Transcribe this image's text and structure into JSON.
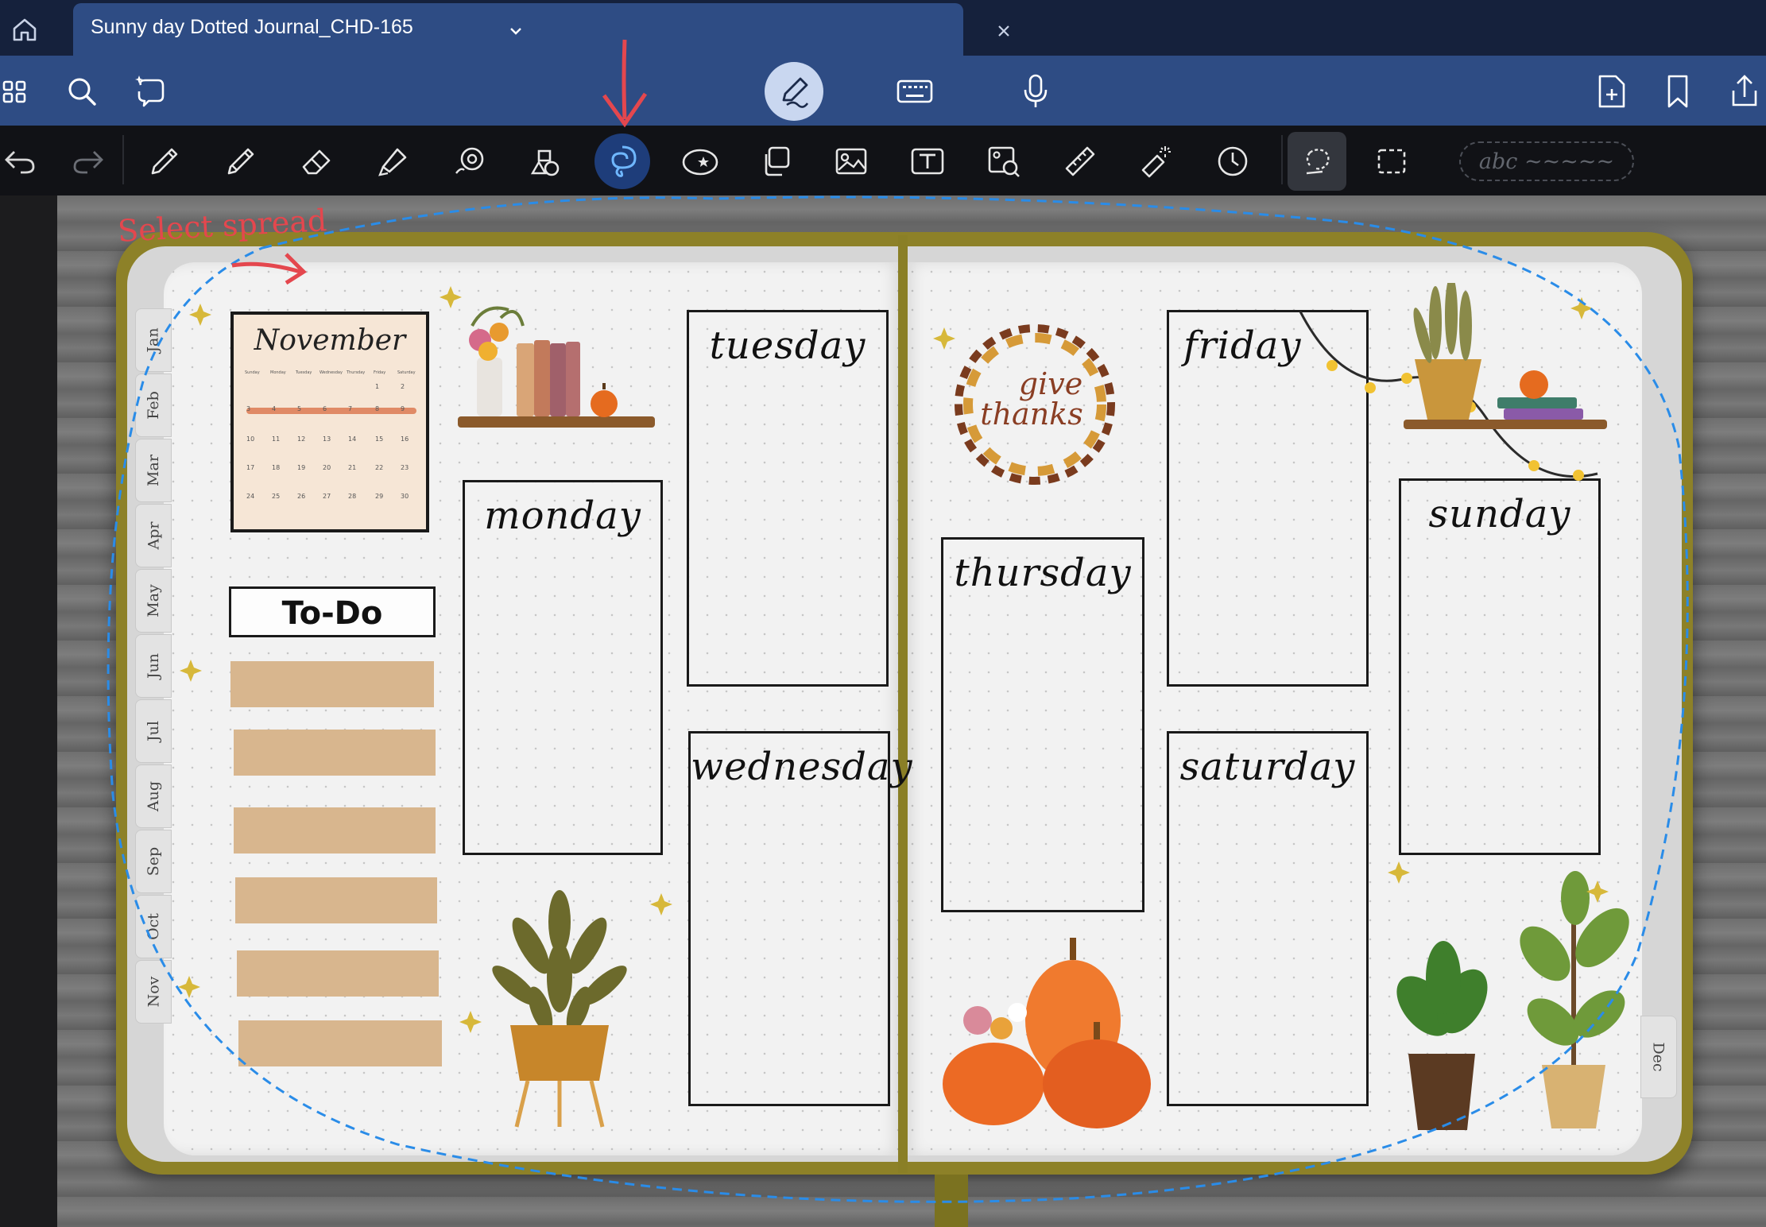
{
  "tab": {
    "title": "Sunny day Dotted Journal_CHD-165",
    "icons": [
      "home-icon",
      "chevron-down-icon",
      "close-icon"
    ]
  },
  "main_toolbar": {
    "left_icons": [
      "thumbnails-grid-icon",
      "search-icon",
      "ai-lasso-icon"
    ],
    "center_icons": [
      "pen-mode-icon",
      "keyboard-icon",
      "microphone-icon"
    ],
    "right_icons": [
      "add-page-icon",
      "bookmark-icon",
      "share-icon"
    ]
  },
  "tools": {
    "items": [
      "undo-icon",
      "redo-icon",
      "pen-icon",
      "pencil-icon",
      "eraser-icon",
      "highlighter-icon",
      "shape-icon",
      "elements-icon",
      "lasso-tool-icon",
      "sticker-icon",
      "copy-icon",
      "image-icon",
      "text-box-icon",
      "camera-image-icon",
      "ruler-icon",
      "laser-pointer-icon",
      "clock-icon",
      "lasso-select-icon",
      "rectangle-select-icon"
    ],
    "handwriting_placeholder": "abc ~~~~~",
    "active_tool": "lasso-tool-icon",
    "accent": "#1e3d7a"
  },
  "annotation": {
    "text": "Select spread",
    "color": "#e4474e"
  },
  "planner": {
    "months": [
      "Jan",
      "Feb",
      "Mar",
      "Apr",
      "May",
      "Jun",
      "Jul",
      "Aug",
      "Sep",
      "Oct",
      "Nov"
    ],
    "right_month": "Dec",
    "calendar": {
      "title": "November",
      "weekdays": [
        "Sunday",
        "Monday",
        "Tuesday",
        "Wednesday",
        "Thursday",
        "Friday",
        "Saturday"
      ],
      "rows": [
        [
          "",
          "",
          "",
          "",
          "",
          "1",
          "2"
        ],
        [
          "3",
          "4",
          "5",
          "6",
          "7",
          "8",
          "9"
        ],
        [
          "10",
          "11",
          "12",
          "13",
          "14",
          "15",
          "16"
        ],
        [
          "17",
          "18",
          "19",
          "20",
          "21",
          "22",
          "23"
        ],
        [
          "24",
          "25",
          "26",
          "27",
          "28",
          "29",
          "30"
        ]
      ]
    },
    "todo": "To-Do",
    "days": {
      "monday": "monday",
      "tuesday": "tuesday",
      "wednesday": "wednesday",
      "thursday": "thursday",
      "friday": "friday",
      "saturday": "saturday",
      "sunday": "sunday"
    },
    "wreath_text_1": "give",
    "wreath_text_2": "thanks"
  },
  "colors": {
    "title_bar": "#15213c",
    "main_bar": "#2e4c84",
    "tool_bar": "#111216",
    "lasso_line": "#2a8ce8",
    "cover": "#8d8128"
  }
}
